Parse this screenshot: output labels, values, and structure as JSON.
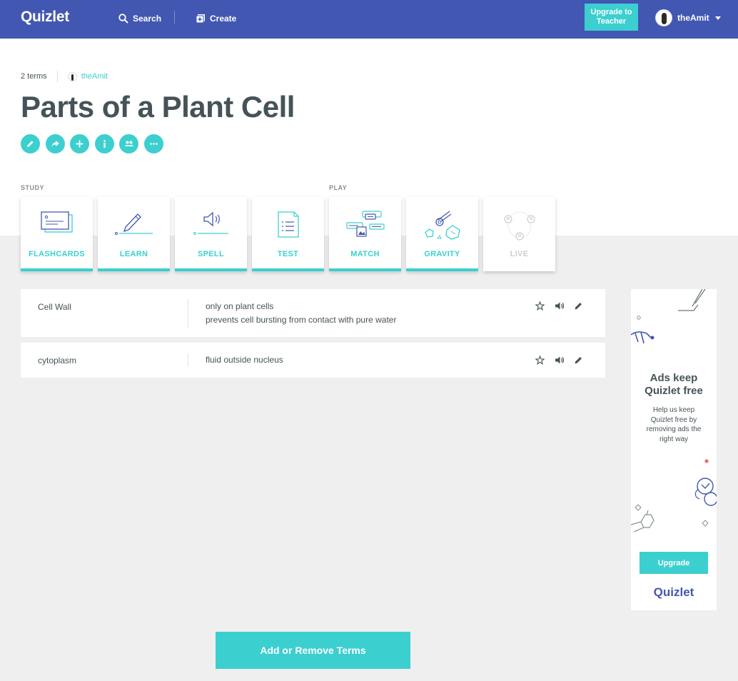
{
  "header": {
    "logo": "Quizlet",
    "search_label": "Search",
    "create_label": "Create",
    "upgrade_label": "Upgrade to\nTeacher",
    "username": "theAmit"
  },
  "set": {
    "term_count": "2 terms",
    "author": "theAmit",
    "title": "Parts of a Plant Cell"
  },
  "sections": {
    "study": "STUDY",
    "play": "PLAY"
  },
  "modes": [
    {
      "label": "FLASHCARDS",
      "icon": "flashcards-icon"
    },
    {
      "label": "LEARN",
      "icon": "learn-icon"
    },
    {
      "label": "SPELL",
      "icon": "spell-icon"
    },
    {
      "label": "TEST",
      "icon": "test-icon"
    },
    {
      "label": "MATCH",
      "icon": "match-icon"
    },
    {
      "label": "GRAVITY",
      "icon": "gravity-icon"
    },
    {
      "label": "LIVE",
      "icon": "live-icon"
    }
  ],
  "terms": [
    {
      "term": "Cell Wall",
      "definition_line1": "only on plant cells",
      "definition_line2": "prevents cell bursting from contact with pure water"
    },
    {
      "term": "cytoplasm",
      "definition_line1": "fluid outside nucleus"
    }
  ],
  "ad": {
    "headline": "Ads keep Quizlet free",
    "body": "Help us keep Quizlet free by removing ads the right way",
    "button": "Upgrade",
    "logo": "Quizlet"
  },
  "footer": {
    "add_terms": "Add or Remove Terms"
  },
  "colors": {
    "brand": "#4257b2",
    "accent": "#3ccfcf",
    "text": "#455358",
    "background": "#efefef"
  }
}
